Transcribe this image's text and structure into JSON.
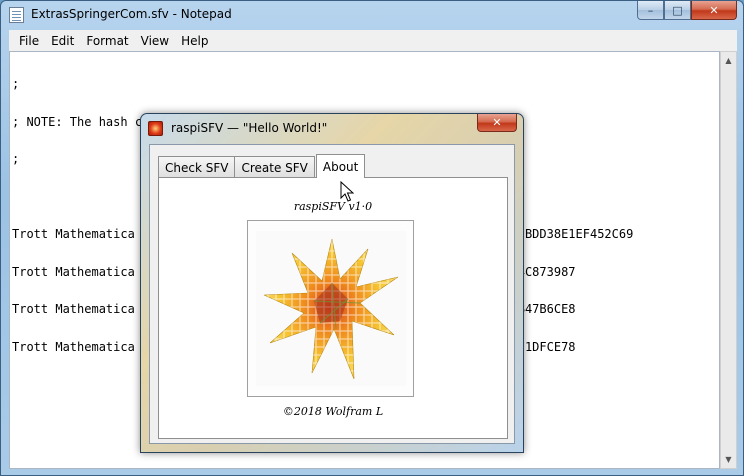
{
  "notepad": {
    "title": "ExtrasSpringerCom.sfv - Notepad",
    "caption": {
      "minimize": "–",
      "maximize": "□",
      "close": "✕"
    },
    "menu": [
      "File",
      "Edit",
      "Format",
      "View",
      "Help"
    ],
    "lines": [
      ";",
      "; NOTE: The hash codes in this SFV file are of type MD5",
      ";",
      "",
      "Trott Mathematica Guidebook 1 (978-0-387-94282-7).zip AD559124CB25FACC5BDD38E1EF452C69",
      "Trott Mathematica                                   ...B7B9A5F492226244C873987",
      "Trott Mathematica                                   ...8127FD6134E1A37B47B6CE8",
      "Trott Mathematica                                   ...07C5572E541BE7971DFCE78"
    ]
  },
  "dialog": {
    "title": "raspiSFV — \"Hello World!\"",
    "close": "✕",
    "tabs": [
      "Check SFV",
      "Create SFV",
      "About"
    ],
    "active_tab": "About",
    "about": {
      "version": "raspiSFV  v1·0",
      "copyright": "©2018  Wolfram  L"
    }
  }
}
